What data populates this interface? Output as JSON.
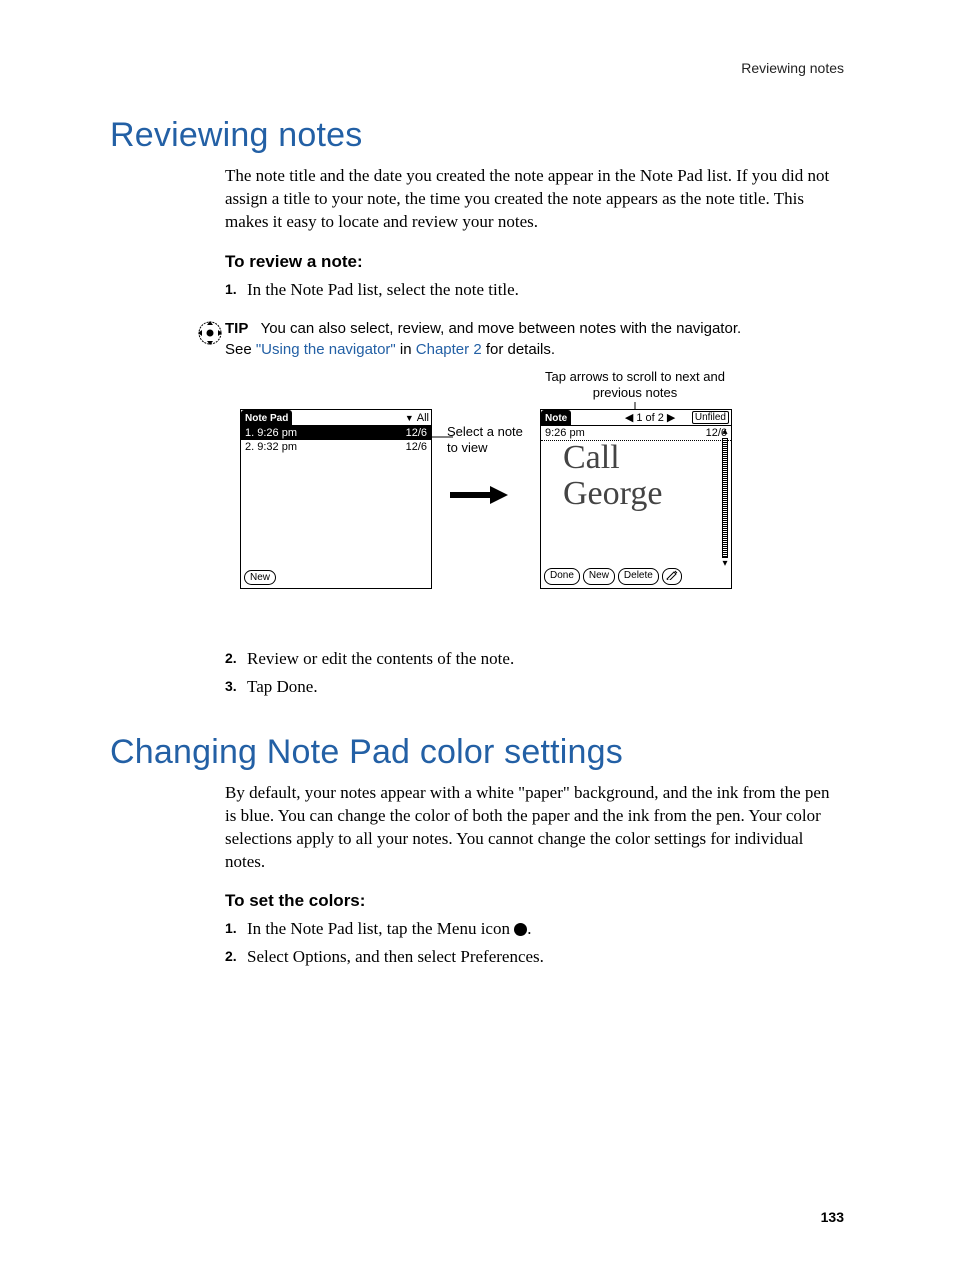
{
  "running_head": "Reviewing notes",
  "section1": {
    "title": "Reviewing notes",
    "intro": "The note title and the date you created the note appear in the Note Pad list. If you did not assign a title to your note, the time you created the note appears as the note title. This makes it easy to locate and review your notes.",
    "subhead": "To review a note:",
    "step1": "In the Note Pad list, select the note title.",
    "tip_label": "TIP",
    "tip_line1": "You can also select, review, and move between notes with the navigator.",
    "tip_see": "See ",
    "tip_link1": "\"Using the navigator\"",
    "tip_in": " in ",
    "tip_link2": "Chapter 2",
    "tip_after": " for details.",
    "callout_scroll": "Tap arrows to scroll to next and previous notes",
    "callout_select": "Select a note to view",
    "palm_list": {
      "title": "Note Pad",
      "category": "All",
      "rows": [
        {
          "left": "1. 9:26 pm",
          "right": "12/6"
        },
        {
          "left": "2. 9:32 pm",
          "right": "12/6"
        }
      ],
      "new_btn": "New"
    },
    "palm_note": {
      "title": "Note",
      "counter": "1 of 2",
      "category": "Unfiled",
      "time": "9:26 pm",
      "date": "12/6",
      "handwriting1": "Call",
      "handwriting2": "George",
      "done": "Done",
      "new": "New",
      "delete": "Delete"
    },
    "step2": "Review or edit the contents of the note.",
    "step3": "Tap Done."
  },
  "section2": {
    "title": "Changing Note Pad color settings",
    "intro": "By default, your notes appear with a white \"paper\" background, and the ink from the pen is blue. You can change the color of both the paper and the ink from the pen. Your color selections apply to all your notes. You cannot change the color settings for individual notes.",
    "subhead": "To set the colors:",
    "step1_before": "In the Note Pad list, tap the Menu icon ",
    "step1_after": ".",
    "step2": "Select Options, and then select Preferences."
  },
  "page_number": "133"
}
